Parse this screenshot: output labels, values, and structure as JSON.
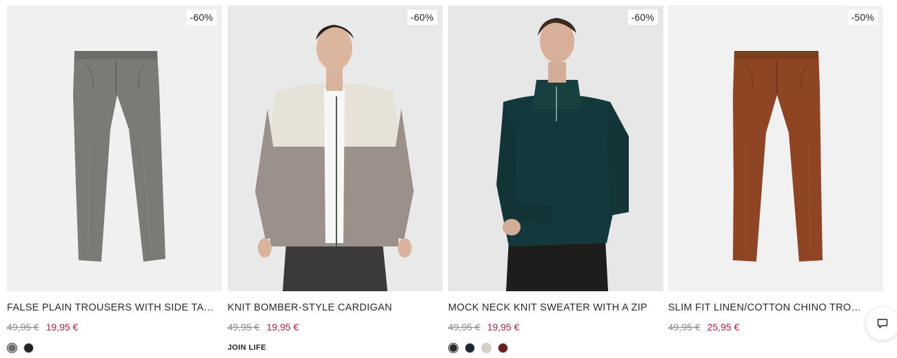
{
  "products": [
    {
      "name": "FALSE PLAIN TROUSERS WITH SIDE TABS",
      "discount": "-60%",
      "old_price": "49,95 €",
      "new_price": "19,95 €",
      "image": "grey-trousers",
      "colors": [
        "#6b6b68",
        "#252525"
      ]
    },
    {
      "name": "KNIT BOMBER-STYLE CARDIGAN",
      "discount": "-60%",
      "old_price": "49,95 €",
      "new_price": "19,95 €",
      "image": "bomber-cardigan-model",
      "tag": "JOIN LIFE"
    },
    {
      "name": "MOCK NECK KNIT SWEATER WITH A ZIP",
      "discount": "-60%",
      "old_price": "49,95 €",
      "new_price": "19,95 €",
      "image": "green-sweater-model",
      "colors": [
        "#2b2b2b",
        "#1c2436",
        "#d6cfc4",
        "#6b1e1e"
      ]
    },
    {
      "name": "SLIM FIT LINEN/COTTON CHINO TROUS...",
      "discount": "-50%",
      "old_price": "49,95 €",
      "new_price": "25,95 €",
      "image": "rust-chinos"
    }
  ],
  "chat": {
    "icon": "chat-bubble-icon"
  }
}
